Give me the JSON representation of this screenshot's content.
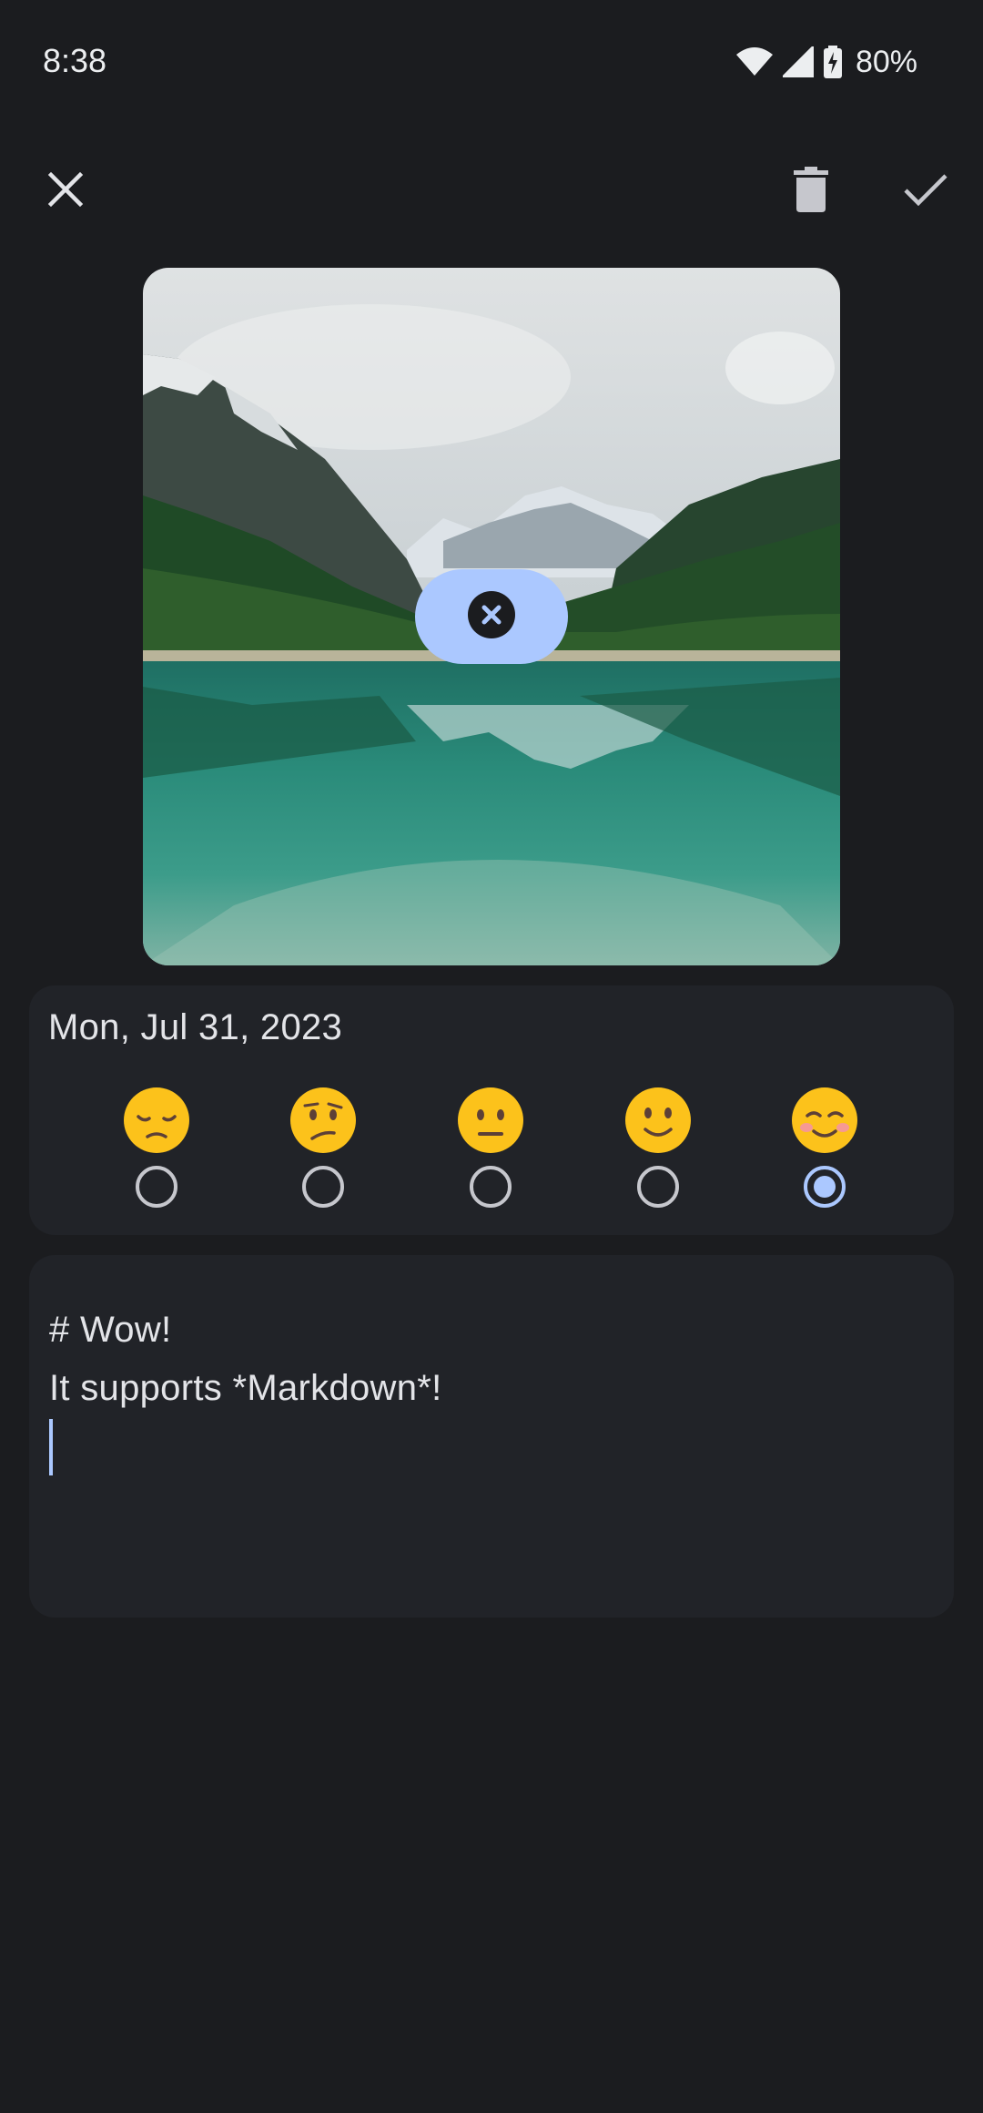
{
  "status_bar": {
    "time": "8:38",
    "battery": "80%",
    "icons": [
      "wifi-icon",
      "cellular-signal-icon",
      "battery-charging-icon"
    ]
  },
  "toolbar": {
    "close_icon": "close-icon",
    "delete_icon": "delete-icon",
    "save_icon": "check-icon"
  },
  "photo": {
    "subject": "mountain lake landscape",
    "remove_icon": "remove-circle-icon"
  },
  "entry": {
    "date": "Mon, Jul 31, 2023",
    "moods": [
      {
        "emoji": "pensive-face",
        "selected": false
      },
      {
        "emoji": "confused-face",
        "selected": false
      },
      {
        "emoji": "neutral-face",
        "selected": false
      },
      {
        "emoji": "slightly-smiling-face",
        "selected": false
      },
      {
        "emoji": "smiling-blushing-face",
        "selected": true
      }
    ]
  },
  "note": {
    "lines": [
      "# Wow!",
      "It supports *Markdown*!"
    ]
  },
  "colors": {
    "background": "#1b1c1f",
    "card": "#212328",
    "accent": "#abc8ff",
    "text": "#e3e4e8"
  }
}
